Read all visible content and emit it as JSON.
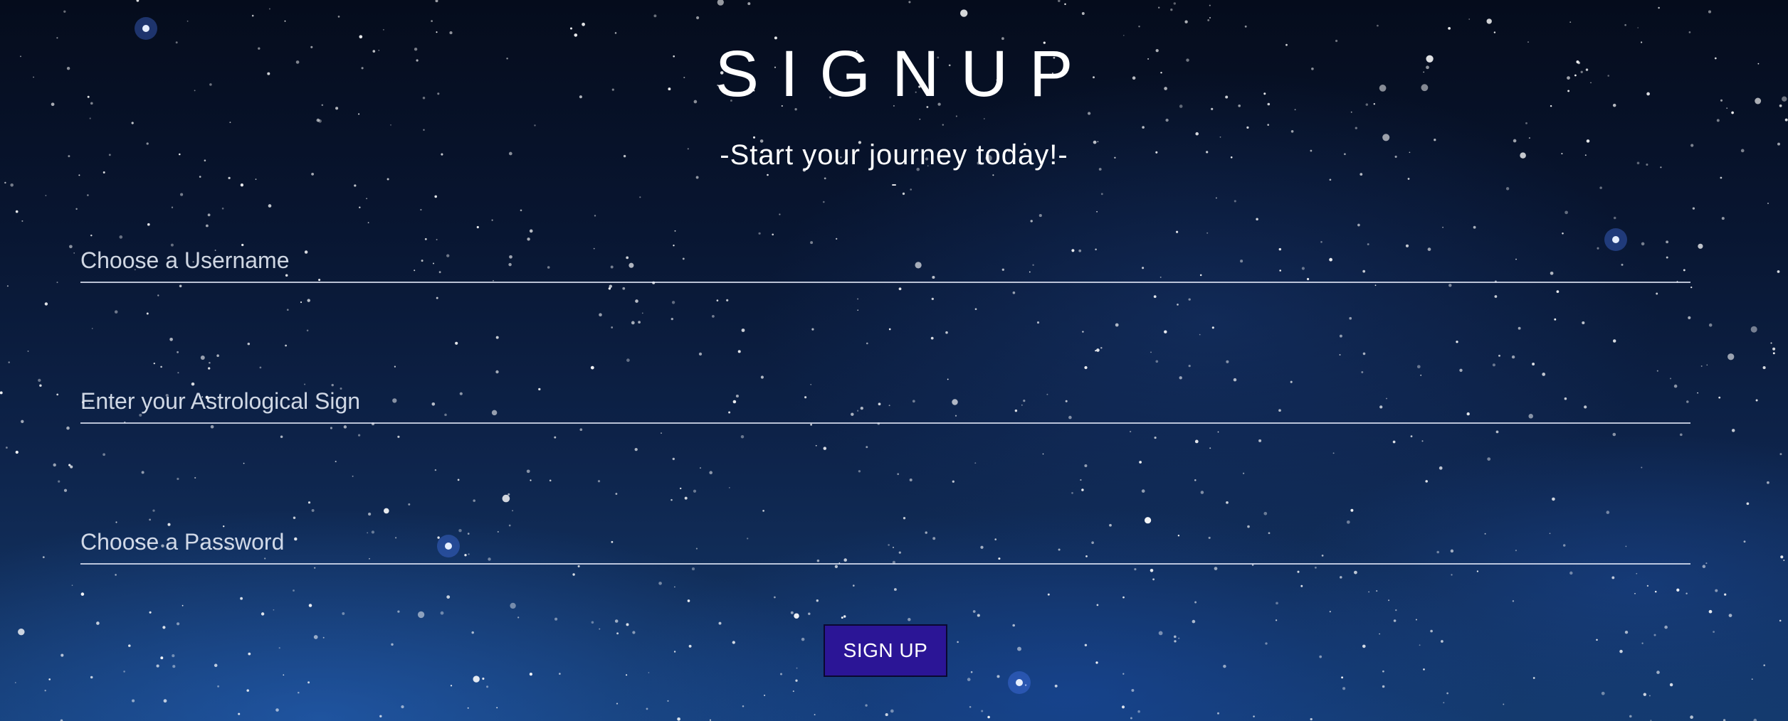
{
  "page": {
    "title": "SIGNUP",
    "subtitle": "-Start your journey today!-",
    "subtitle_trailing": "-"
  },
  "form": {
    "username_placeholder": "Choose a Username",
    "sign_placeholder": "Enter your Astrological Sign",
    "password_placeholder": "Choose a Password",
    "username_value": "",
    "sign_value": "",
    "password_value": "",
    "submit_label": "SIGN UP"
  },
  "colors": {
    "button_background": "#2b1596",
    "text": "#ffffff",
    "input_underline": "#ebf0ff"
  }
}
